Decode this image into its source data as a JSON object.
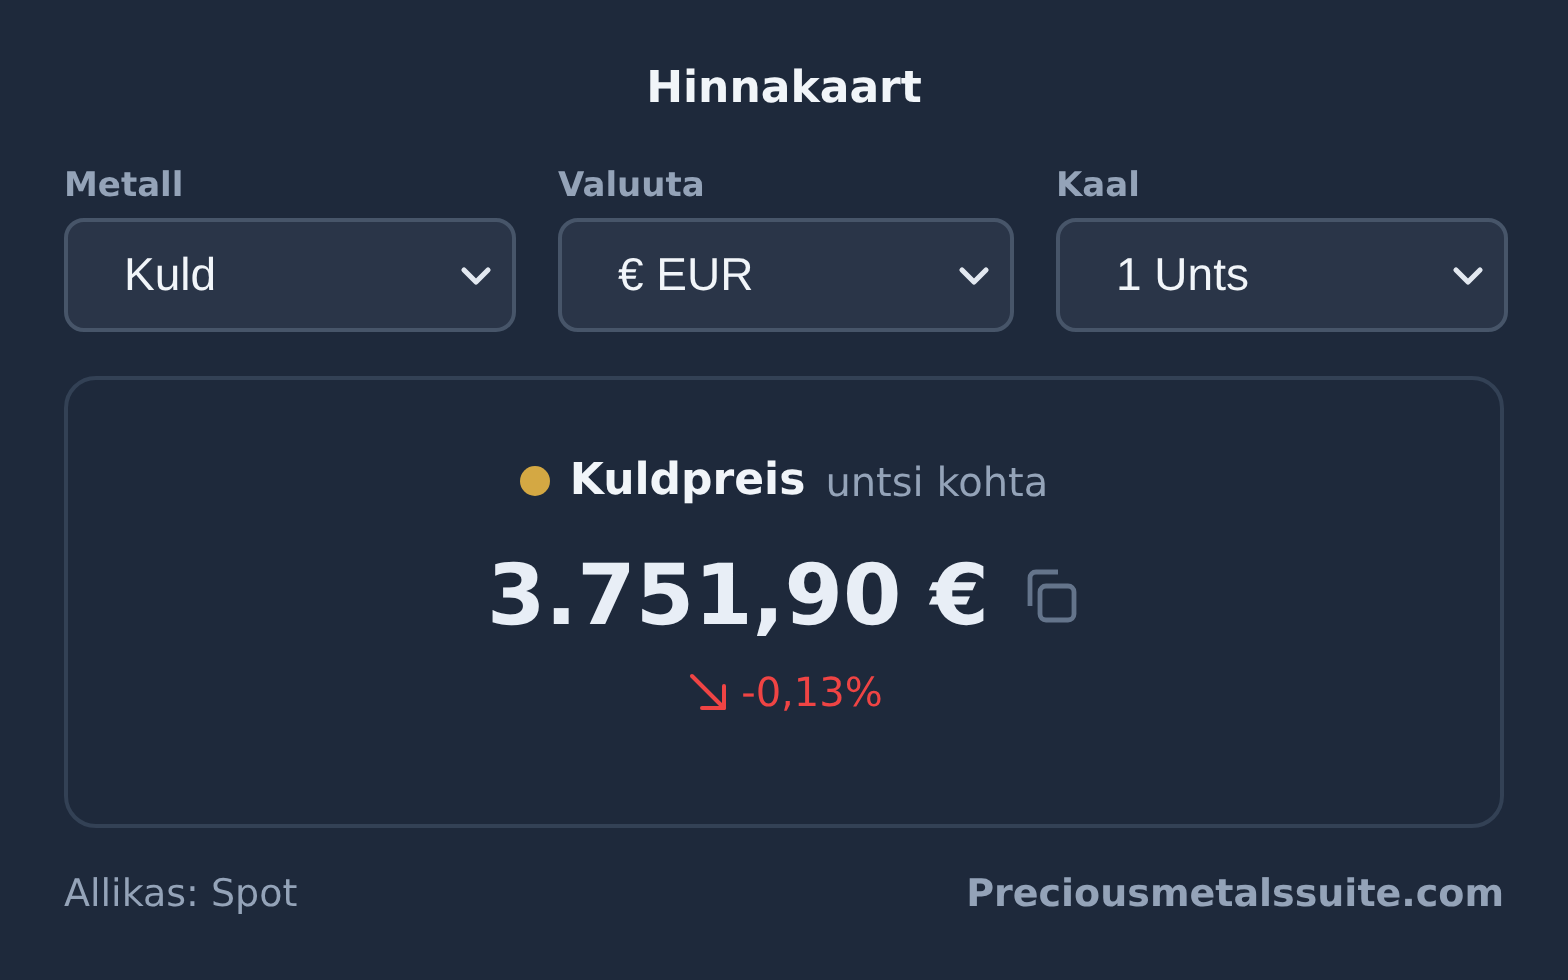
{
  "title": "Hinnakaart",
  "selectors": [
    {
      "label": "Metall",
      "value": "Kuld"
    },
    {
      "label": "Valuuta",
      "value": "€ EUR"
    },
    {
      "label": "Kaal",
      "value": "1 Unts"
    }
  ],
  "price_panel": {
    "name": "Kuldpreis",
    "unit": "untsi kohta",
    "color": "#d4a843",
    "price": "3.751,90 €",
    "change": {
      "falling": true,
      "text": "-0,13%"
    }
  },
  "footer": {
    "source": "Allikas: Spot",
    "link": "Preciousmetalssuite.com"
  }
}
